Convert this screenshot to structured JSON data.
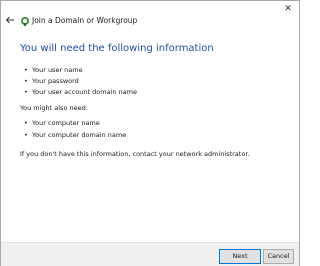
{
  "window": {
    "title": "Join a Domain or Workgroup",
    "heading": "You will need the following information",
    "required_items": [
      "Your user name",
      "Your password",
      "Your user account domain name"
    ],
    "optional_intro": "You might also need:",
    "optional_items": [
      "Your computer name",
      "Your computer domain name"
    ],
    "note": "If you don't have this information, contact your network administrator."
  },
  "buttons": {
    "next": "Next",
    "cancel": "Cancel"
  },
  "icons": {
    "back": "back-arrow-icon",
    "wizard": "network-wizard-icon",
    "close": "close-icon"
  },
  "colors": {
    "heading": "#1f4fa3",
    "accent": "#0078d7"
  }
}
